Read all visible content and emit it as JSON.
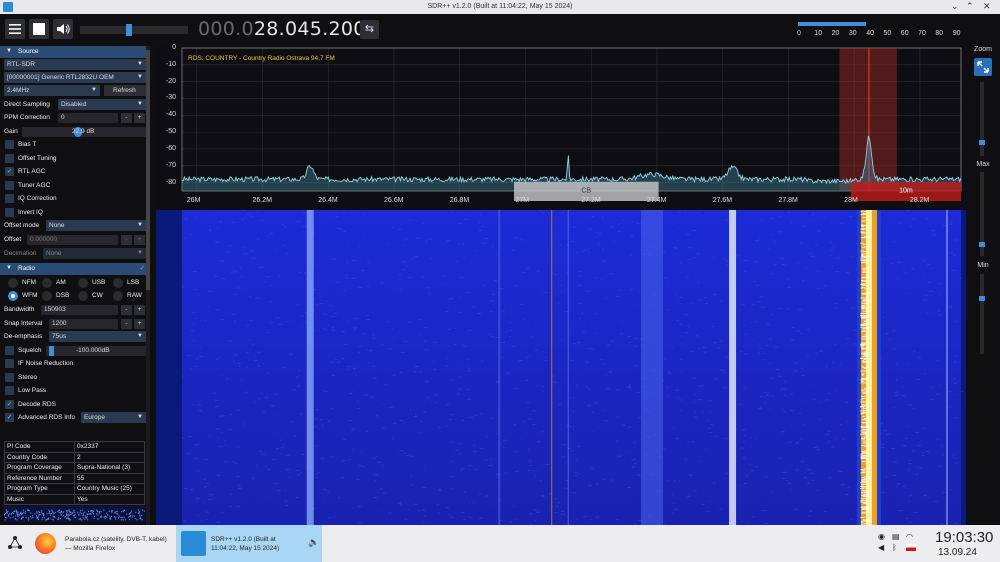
{
  "window": {
    "title": "SDR++ v1.2.0 (Built at 11:04:22, May 15 2024)"
  },
  "toolbar": {
    "freq_dim": "000.0",
    "freq_main": "28.045.200",
    "snr_scale": [
      "0",
      "10",
      "20",
      "30",
      "40",
      "50",
      "60",
      "70",
      "80",
      "90"
    ],
    "snr_level": 0.43
  },
  "source": {
    "header": "Source",
    "device_type": "RTL-SDR",
    "device": "[00000001] Generic RTL2832U OEM",
    "samplerate": "2.4MHz",
    "refresh_label": "Refresh",
    "direct_sampling_label": "Direct Sampling",
    "direct_sampling_value": "Disabled",
    "ppm_label": "PPM Correction",
    "ppm_value": "0",
    "gain_label": "Gain",
    "gain_value": "22.9 dB",
    "bias_t": "Bias T",
    "offset_tuning": "Offset Tuning",
    "rtl_agc": "RTL AGC",
    "tuner_agc": "Tuner AGC",
    "iq_correction": "IQ Correction",
    "invert_iq": "Invert IQ",
    "offset_mode_label": "Offset mode",
    "offset_mode_value": "None",
    "offset_label": "Offset",
    "offset_value": "0.000000",
    "decimation_label": "Decimation",
    "decimation_value": "None"
  },
  "radio": {
    "header": "Radio",
    "modes": [
      "NFM",
      "AM",
      "USB",
      "LSB",
      "WFM",
      "DSB",
      "CW",
      "RAW"
    ],
    "selected_mode": "WFM",
    "bandwidth_label": "Bandwidth",
    "bandwidth_value": "150903",
    "snap_label": "Snap Interval",
    "snap_value": "1200",
    "deemph_label": "De-emphasis",
    "deemph_value": "75us",
    "squelch_label": "Squelch",
    "squelch_value": "-100.000dB",
    "if_nr": "IF Noise Reduction",
    "stereo": "Stereo",
    "low_pass": "Low Pass",
    "decode_rds": "Decode RDS",
    "adv_rds": "Advanced RDS Info",
    "region": "Europe"
  },
  "rds_table": [
    [
      "PI Code",
      "0x2337"
    ],
    [
      "Country Code",
      "2"
    ],
    [
      "Program Coverage",
      "Supra-National (3)"
    ],
    [
      "Reference Number",
      "55"
    ],
    [
      "Program Type",
      "Country Music (25)"
    ],
    [
      "Music",
      "Yes"
    ]
  ],
  "fft": {
    "rds_text": "RDS: COUNTRY  - Country Radio Ostrava 94,7 FM",
    "y_ticks": [
      "0",
      "-10",
      "-20",
      "-30",
      "-40",
      "-50",
      "-60",
      "-70",
      "-80"
    ],
    "x_ticks": [
      "26M",
      "26.2M",
      "26.4M",
      "26.6M",
      "26.8M",
      "27M",
      "27.2M",
      "27.4M",
      "27.6M",
      "27.8M",
      "28M",
      "28.2M"
    ],
    "bands": [
      {
        "label": "CB"
      },
      {
        "label": "10m"
      }
    ]
  },
  "right_panel": {
    "zoom": "Zoom",
    "max": "Max",
    "min": "Min"
  },
  "taskbar": {
    "firefox_title": "Parabola.cz (satelity, DVB-T, kabel) — Mozilla Firefox",
    "sdr_title": "SDR++ v1.2.0 (Built at 11:04:22, May 15 2024)",
    "time": "19:03:30",
    "date": "13.09.24"
  },
  "colors": {
    "accent": "#3d8fd8",
    "header": "#294b74",
    "waterfall": "#1a2bd0",
    "rds": "#e7cc35"
  }
}
